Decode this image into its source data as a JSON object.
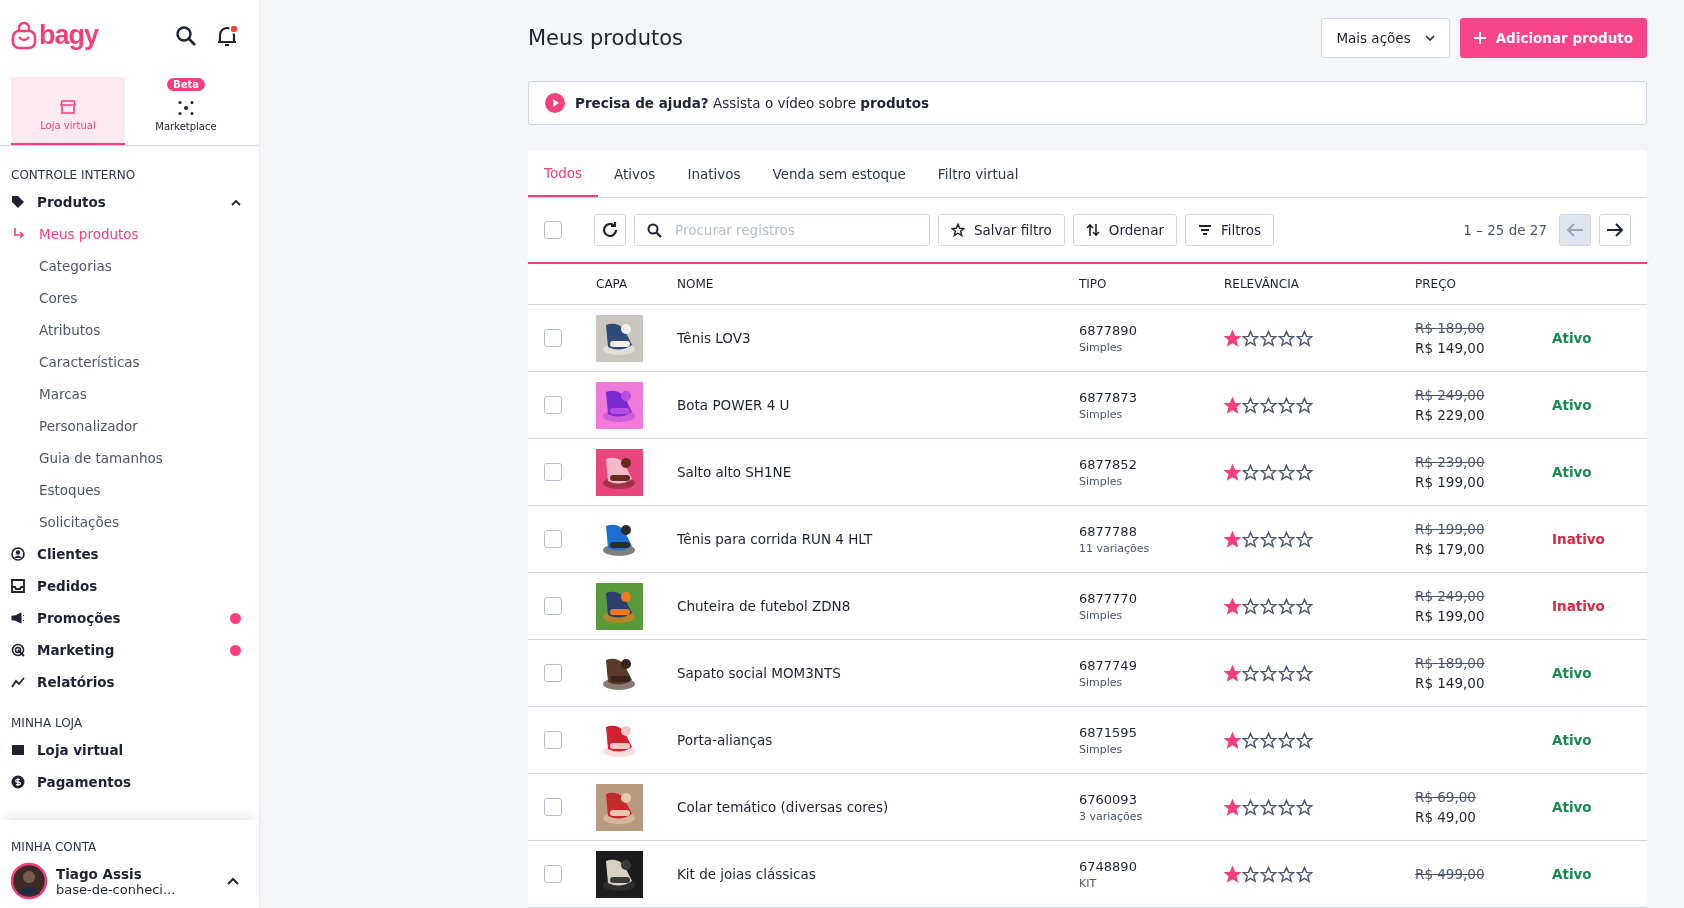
{
  "brand": {
    "logo": "bagy"
  },
  "notifications": {
    "unread": true
  },
  "channels": [
    {
      "label": "Loja virtual",
      "selected": true
    },
    {
      "label": "Marketplace",
      "selected": false,
      "badge": "Beta"
    }
  ],
  "sidebar": {
    "sections": [
      {
        "title": "CONTROLE INTERNO",
        "items": [
          {
            "label": "Produtos",
            "expanded": true,
            "dot": false,
            "children": [
              {
                "label": "Meus produtos",
                "selected": true
              },
              {
                "label": "Categorias",
                "selected": false
              },
              {
                "label": "Cores",
                "selected": false
              },
              {
                "label": "Atributos",
                "selected": false
              },
              {
                "label": "Características",
                "selected": false
              },
              {
                "label": "Marcas",
                "selected": false
              },
              {
                "label": "Personalizador",
                "selected": false
              },
              {
                "label": "Guia de tamanhos",
                "selected": false
              },
              {
                "label": "Estoques",
                "selected": false
              },
              {
                "label": "Solicitações",
                "selected": false
              }
            ]
          },
          {
            "label": "Clientes",
            "dot": false
          },
          {
            "label": "Pedidos",
            "dot": false
          },
          {
            "label": "Promoções",
            "dot": true
          },
          {
            "label": "Marketing",
            "dot": true
          },
          {
            "label": "Relatórios",
            "dot": false
          }
        ]
      },
      {
        "title": "MINHA LOJA",
        "items": [
          {
            "label": "Loja virtual",
            "dot": false
          },
          {
            "label": "Pagamentos",
            "dot": false
          }
        ]
      }
    ],
    "account": {
      "title": "MINHA CONTA",
      "name": "Tiago Assis",
      "store": "base-de-conheci..."
    }
  },
  "page": {
    "title": "Meus produtos",
    "more_actions": "Mais ações",
    "add_button": "Adicionar produto"
  },
  "help": {
    "text": "**Precisa de ajuda?** Assista o vídeo sobre **produtos**"
  },
  "tabs": [
    {
      "label": "Todos",
      "selected": true
    },
    {
      "label": "Ativos",
      "selected": false
    },
    {
      "label": "Inativos",
      "selected": false
    },
    {
      "label": "Venda sem estoque",
      "selected": false
    },
    {
      "label": "Filtro virtual",
      "selected": false
    }
  ],
  "toolbar": {
    "select_all_checked": false,
    "search_placeholder": "Procurar registros",
    "save_filter": "Salvar filtro",
    "sort": "Ordenar",
    "filters": "Filtros",
    "pagination": "1 – 25 de 27",
    "prev_disabled": true
  },
  "table": {
    "columns": [
      "CAPA",
      "NOME",
      "TIPO",
      "RELEVÂNCIA",
      "PREÇO"
    ],
    "rows": [
      {
        "name": "Tênis LOV3",
        "code": "6877890",
        "type": "Simples",
        "stars": 1,
        "old_price": "R$ 189,00",
        "price": "R$ 149,00",
        "status": "Ativo",
        "active": true,
        "checked": false
      },
      {
        "name": "Bota POWER 4 U",
        "code": "6877873",
        "type": "Simples",
        "stars": 1,
        "old_price": "R$ 249,00",
        "price": "R$ 229,00",
        "status": "Ativo",
        "active": true,
        "checked": false
      },
      {
        "name": "Salto alto SH1NE",
        "code": "6877852",
        "type": "Simples",
        "stars": 1,
        "old_price": "R$ 239,00",
        "price": "R$ 199,00",
        "status": "Ativo",
        "active": true,
        "checked": false
      },
      {
        "name": "Tênis para corrida RUN 4 HLT",
        "code": "6877788",
        "type": "11 variações",
        "stars": 1,
        "old_price": "R$ 199,00",
        "price": "R$ 179,00",
        "status": "Inativo",
        "active": false,
        "checked": false
      },
      {
        "name": "Chuteira de futebol ZDN8",
        "code": "6877770",
        "type": "Simples",
        "stars": 1,
        "old_price": "R$ 249,00",
        "price": "R$ 199,00",
        "status": "Inativo",
        "active": false,
        "checked": false
      },
      {
        "name": "Sapato social MOM3NTS",
        "code": "6877749",
        "type": "Simples",
        "stars": 1,
        "old_price": "R$ 189,00",
        "price": "R$ 149,00",
        "status": "Ativo",
        "active": true,
        "checked": false
      },
      {
        "name": "Porta-alianças",
        "code": "6871595",
        "type": "Simples",
        "stars": 1,
        "status": "Ativo",
        "active": true,
        "checked": false
      },
      {
        "name": "Colar temático (diversas cores)",
        "code": "6760093",
        "type": "3 variações",
        "stars": 1,
        "old_price": "R$ 69,00",
        "price": "R$ 49,00",
        "status": "Ativo",
        "active": true,
        "checked": false
      },
      {
        "name": "Kit de joias clássicas",
        "code": "6748890",
        "type": "KIT",
        "stars": 1,
        "old_price": "R$ 499,00",
        "status": "Ativo",
        "active": true,
        "checked": false
      }
    ]
  }
}
